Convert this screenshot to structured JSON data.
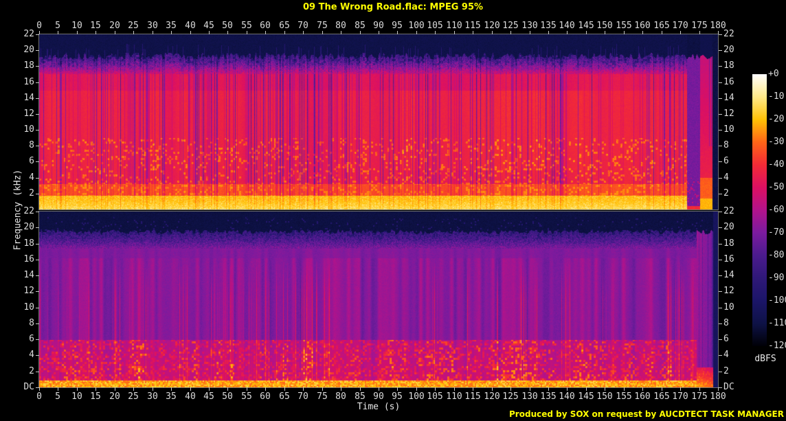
{
  "title": "09 The Wrong Road.flac: MPEG 95%",
  "footer": "Produced by SOX on request by AUCDTECT TASK MANAGER",
  "x_axis_label": "Time (s)",
  "y_axis_label": "Frequency (kHz)",
  "time_tick_labels": [
    "0",
    "5",
    "10",
    "15",
    "20",
    "25",
    "30",
    "35",
    "40",
    "45",
    "50",
    "55",
    "60",
    "65",
    "70",
    "75",
    "80",
    "85",
    "90",
    "95",
    "100",
    "105",
    "110",
    "115",
    "120",
    "125",
    "130",
    "135",
    "140",
    "145",
    "150",
    "155",
    "160",
    "165",
    "170",
    "175",
    "180"
  ],
  "panel1_freq_labels": [
    "22",
    "20",
    "18",
    "16",
    "14",
    "12",
    "10",
    "8",
    "6",
    "4",
    "2"
  ],
  "panel2_freq_labels": [
    "22",
    "20",
    "18",
    "16",
    "14",
    "12",
    "10",
    "8",
    "6",
    "4",
    "2",
    "DC"
  ],
  "colorbar": {
    "unit_label": "dBFS",
    "tick_labels": [
      "+0",
      "-10",
      "-20",
      "-30",
      "-40",
      "-50",
      "-60",
      "-70",
      "-80",
      "-90",
      "-100",
      "-110",
      "-120"
    ]
  },
  "accent_color": "#ffff00",
  "tick_text_color": "#dcdcdc",
  "chart_data": {
    "type": "heatmap",
    "subtype": "audio-spectrogram-dual-channel",
    "title": "09 The Wrong Road.flac: MPEG 95%",
    "xlabel": "Time (s)",
    "ylabel": "Frequency (kHz)",
    "x_range_s": [
      0,
      180
    ],
    "x_tick_step_s": 5,
    "y_range_khz": [
      0,
      22
    ],
    "y_tick_step_khz": 2,
    "y_bottom_label": "DC",
    "grid": false,
    "legend": "colorbar right, dBFS -120..+0 step 10",
    "colorbar_range_db": [
      -120,
      0
    ],
    "lowpass_cutoff_khz": 19.2,
    "events": {
      "quiet_passage_start_s": 171.7,
      "final_hit_start_s": 175.2,
      "audio_end_s": 178.5
    },
    "channels": [
      {
        "name": "channel-1",
        "description": "Loud channel: dense red energy up to ~17 kHz cut by purple transient stripes; bright yellow-orange band below ~2 kHz; jagged MPEG lowpass cutoff near 19.2 kHz with black above; purple quiet passage ~172-175 s, red final hit ~175-178.5 s, silence after."
      },
      {
        "name": "channel-2",
        "description": "Quiet channel: violet-purple background with magenta/red vertical streaks; orange-yellow bursts below ~6 kHz; speckled yellow band near DC; noisy purple band up to ~19.4 kHz cutoff, black above; fade-out ending ~178.5 s."
      }
    ],
    "palette_stops": [
      {
        "db": -120,
        "hex": "#000006"
      },
      {
        "db": -110,
        "hex": "#0e1246"
      },
      {
        "db": -100,
        "hex": "#1b1568"
      },
      {
        "db": -90,
        "hex": "#2f1878"
      },
      {
        "db": -80,
        "hex": "#4b1b8e"
      },
      {
        "db": -70,
        "hex": "#7b1b9e"
      },
      {
        "db": -60,
        "hex": "#b2138b"
      },
      {
        "db": -50,
        "hex": "#dc1062"
      },
      {
        "db": -40,
        "hex": "#f32b36"
      },
      {
        "db": -30,
        "hex": "#ff6517"
      },
      {
        "db": -20,
        "hex": "#ffc105"
      },
      {
        "db": -10,
        "hex": "#ffe98a"
      },
      {
        "db": 0,
        "hex": "#ffffff"
      }
    ]
  }
}
